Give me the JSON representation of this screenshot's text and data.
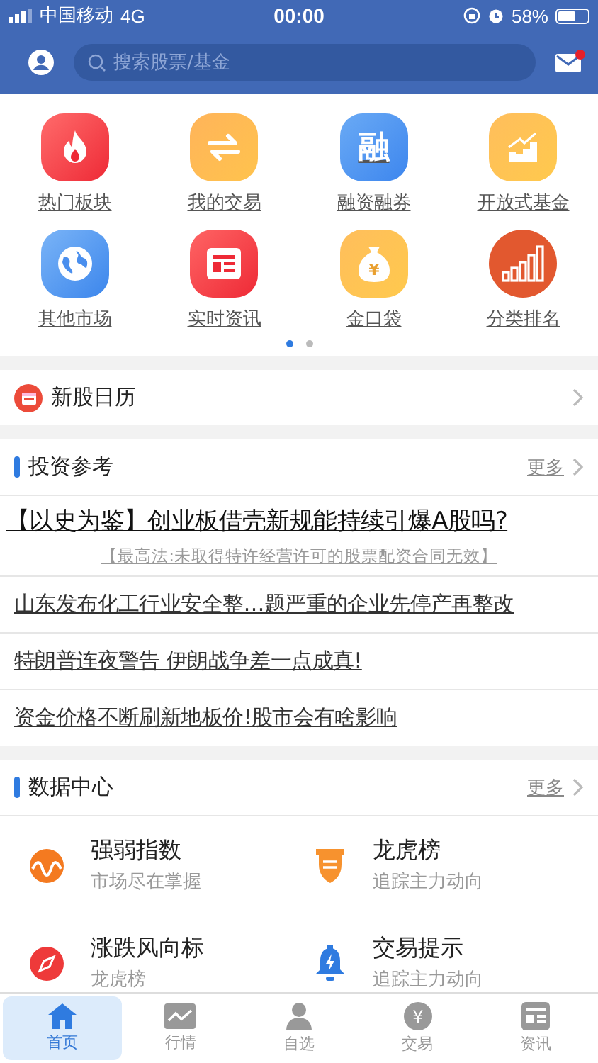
{
  "status_bar": {
    "carrier": "中国移动",
    "network": "4G",
    "time": "00:00",
    "battery": "58%"
  },
  "header": {
    "search": {
      "placeholder": "搜索股票/基金"
    },
    "mail_unread": true
  },
  "shortcuts": [
    {
      "label": "热门板块",
      "kind": "fire"
    },
    {
      "label": "我的交易",
      "kind": "swap"
    },
    {
      "label": "融资融券",
      "kind": "glyph",
      "glyph": "融"
    },
    {
      "label": "开放式基金",
      "kind": "stairs"
    },
    {
      "label": "其他市场",
      "kind": "globe"
    },
    {
      "label": "实时资讯",
      "kind": "news"
    },
    {
      "label": "金口袋",
      "kind": "bag",
      "glyph": "¥"
    },
    {
      "label": "分类排名",
      "kind": "bars"
    }
  ],
  "pager": [
    {
      "selected": true
    },
    {
      "selected": false
    }
  ],
  "ipo_calendar": {
    "label": "新股日历"
  },
  "investment": {
    "title": "投资参考",
    "more": "更多",
    "headline": "【以史为鉴】创业板借壳新规能持续引爆A股吗?",
    "subheadline": "【最高法:未取得特许经营许可的股票配资合同无效】",
    "items": [
      "山东发布化工行业安全整…题严重的企业先停产再整改",
      "特朗普连夜警告 伊朗战争差一点成真!",
      "资金价格不断刷新地板价!股市会有啥影响"
    ]
  },
  "data_center": {
    "title": "数据中心",
    "more": "更多",
    "items": [
      {
        "title": "强弱指数",
        "subtitle": "市场尽在掌握",
        "kind": "wave"
      },
      {
        "title": "龙虎榜",
        "subtitle": "追踪主力动向",
        "kind": "shield"
      },
      {
        "title": "涨跌风向标",
        "subtitle": "龙虎榜",
        "kind": "compass"
      },
      {
        "title": "交易提示",
        "subtitle": "追踪主力动向",
        "kind": "bell"
      }
    ]
  },
  "tabs": [
    {
      "label": "首页",
      "kind": "home",
      "selected": true
    },
    {
      "label": "行情",
      "kind": "chart",
      "selected": false
    },
    {
      "label": "自选",
      "kind": "person",
      "selected": false
    },
    {
      "label": "交易",
      "kind": "coin",
      "glyph": "¥",
      "selected": false
    },
    {
      "label": "资讯",
      "kind": "news",
      "selected": false
    }
  ]
}
